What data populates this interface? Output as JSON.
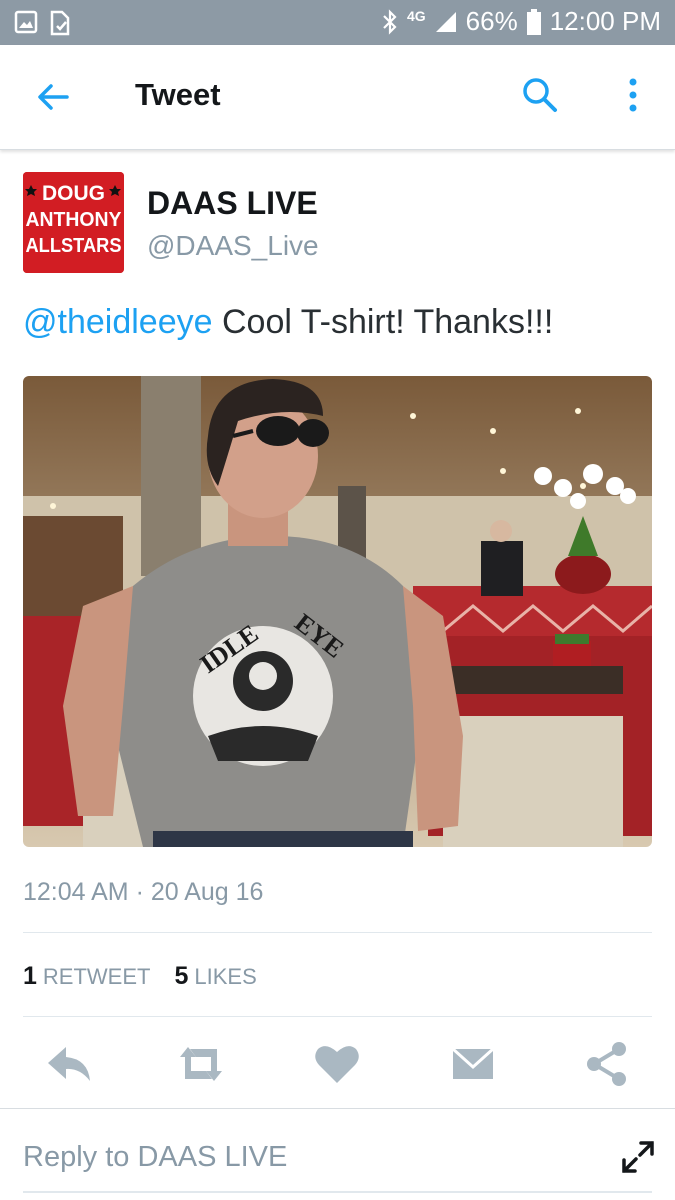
{
  "status_bar": {
    "network": "4G",
    "battery": "66%",
    "time": "12:00 PM"
  },
  "app_bar": {
    "title": "Tweet"
  },
  "tweet": {
    "author": {
      "name": "DAAS LIVE",
      "handle": "@DAAS_Live",
      "avatar_text": [
        "DOUG",
        "ANTHONY",
        "ALLSTARS"
      ]
    },
    "mention": "@theidleeye",
    "text": "Cool T-shirt! Thanks!!!",
    "photo": {
      "shirt_text_left": "IDLE",
      "shirt_text_right": "EYE"
    },
    "timestamp": "12:04 AM · 20 Aug 16",
    "stats": {
      "retweets_count": "1",
      "retweets_label": "RETWEET",
      "likes_count": "5",
      "likes_label": "LIKES"
    }
  },
  "actions": [
    "reply-icon",
    "retweet-icon",
    "heart-icon",
    "message-icon",
    "share-icon"
  ],
  "reply_bar": {
    "placeholder": "Reply to DAAS LIVE"
  },
  "colors": {
    "accent": "#1da1f2",
    "icon_gray": "#aab8c2",
    "status_bar": "#8d9aa5",
    "avatar_red": "#d21d23"
  }
}
